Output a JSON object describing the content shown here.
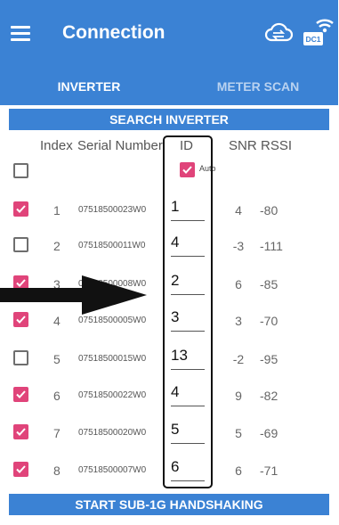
{
  "app_bar": {
    "title": "Connection",
    "menu_icon": "hamburger-menu-icon",
    "cloud_icon": "cloud-sync-icon",
    "device_badge": "DC1",
    "device_icon": "dc1-wifi-device-icon"
  },
  "tabs": [
    {
      "label": "INVERTER",
      "selected": true
    },
    {
      "label": "METER SCAN",
      "selected": false
    }
  ],
  "search_button": "SEARCH INVERTER",
  "table": {
    "headers": {
      "index": "Index",
      "serial": "Serial Number",
      "id": "ID",
      "snr": "SNR",
      "rssi": "RSSI"
    },
    "auto_label": "Auto",
    "auto_checked": true,
    "select_all_checked": false,
    "rows": [
      {
        "checked": true,
        "index": "1",
        "serial": "07518500023W0",
        "id": "1",
        "snr": "4",
        "rssi": "-80"
      },
      {
        "checked": false,
        "index": "2",
        "serial": "07518500011W0",
        "id": "4",
        "snr": "-3",
        "rssi": "-111"
      },
      {
        "checked": true,
        "index": "3",
        "serial": "07518500008W0",
        "id": "2",
        "snr": "6",
        "rssi": "-85"
      },
      {
        "checked": true,
        "index": "4",
        "serial": "07518500005W0",
        "id": "3",
        "snr": "3",
        "rssi": "-70"
      },
      {
        "checked": false,
        "index": "5",
        "serial": "07518500015W0",
        "id": "13",
        "snr": "-2",
        "rssi": "-95"
      },
      {
        "checked": true,
        "index": "6",
        "serial": "07518500022W0",
        "id": "4",
        "snr": "9",
        "rssi": "-82"
      },
      {
        "checked": true,
        "index": "7",
        "serial": "07518500020W0",
        "id": "5",
        "snr": "5",
        "rssi": "-69"
      },
      {
        "checked": true,
        "index": "8",
        "serial": "07518500007W0",
        "id": "6",
        "snr": "6",
        "rssi": "-71"
      }
    ]
  },
  "start_button": "START SUB-1G HANDSHAKING",
  "colors": {
    "primary": "#3b82d4",
    "checkbox_checked": "#e0447a",
    "annotation": "#111111"
  }
}
